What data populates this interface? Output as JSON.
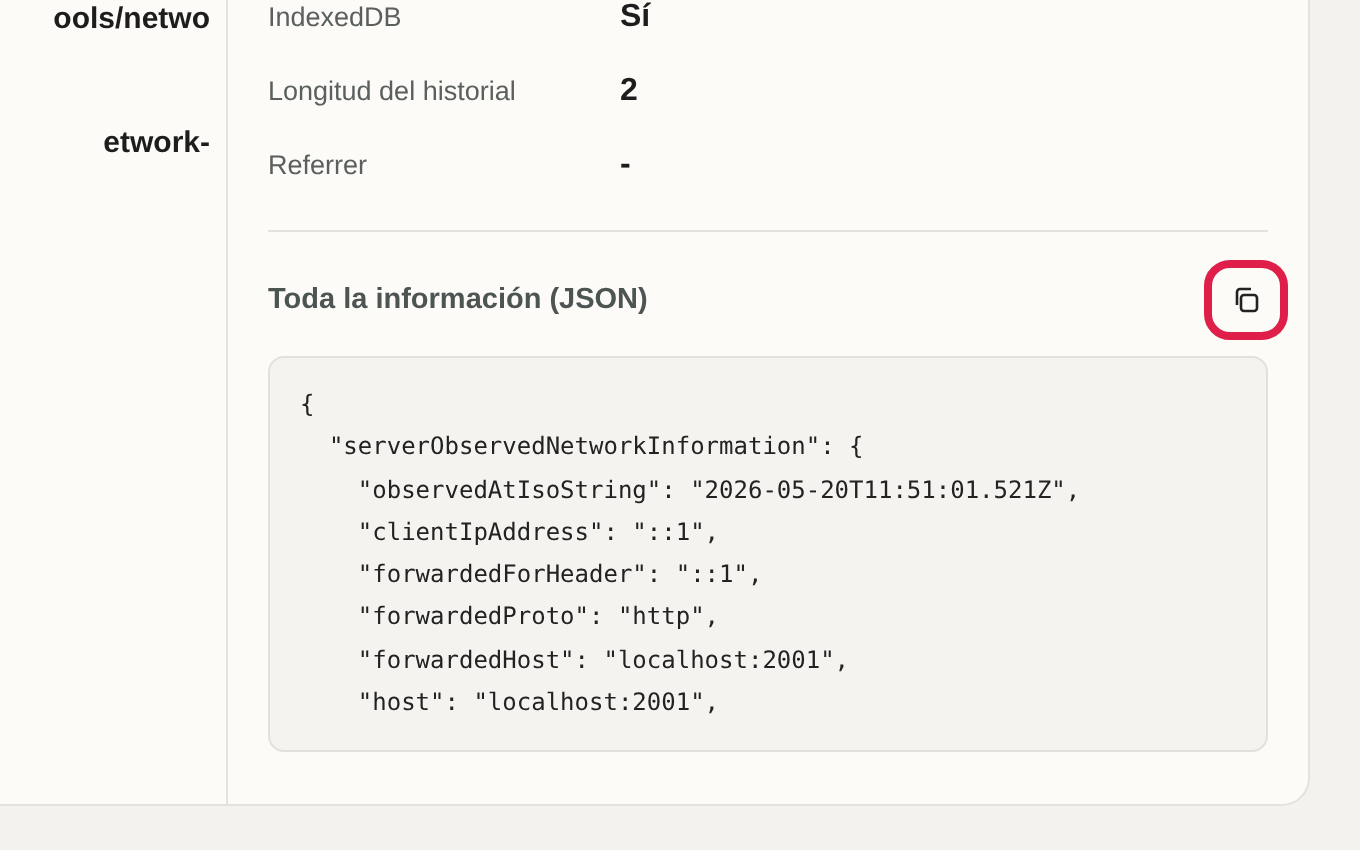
{
  "left_column": {
    "lines": [
      "ools/netwo",
      "etwork-"
    ]
  },
  "details": [
    {
      "label": "IndexedDB",
      "value": "Sí"
    },
    {
      "label": "Longitud del historial",
      "value": "2"
    },
    {
      "label": "Referrer",
      "value": "-"
    }
  ],
  "json_section": {
    "title": "Toda la información (JSON)",
    "copy_highlighted": true,
    "code_lines": [
      "{",
      "  \"serverObservedNetworkInformation\": {",
      "    \"observedAtIsoString\": \"2026-05-20T11:51:01.521Z\",",
      "    \"clientIpAddress\": \"::1\",",
      "    \"forwardedForHeader\": \"::1\",",
      "    \"forwardedProto\": \"http\",",
      "    \"forwardedHost\": \"localhost:2001\",",
      "    \"host\": \"localhost:2001\","
    ]
  }
}
